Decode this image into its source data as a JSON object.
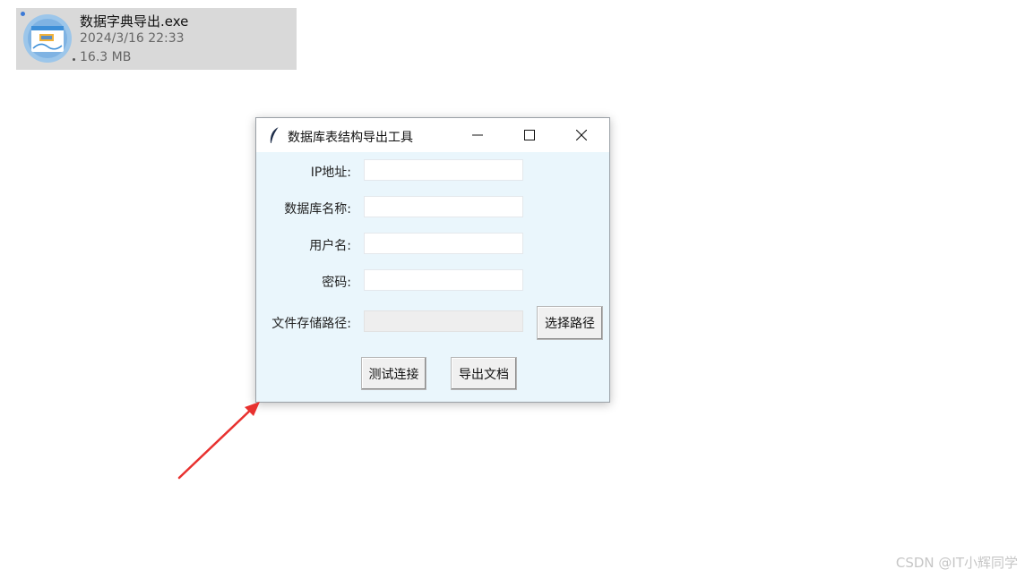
{
  "file": {
    "name": "数据字典导出.exe",
    "date": "2024/3/16 22:33",
    "size": "16.3 MB"
  },
  "window": {
    "title": "数据库表结构导出工具",
    "fields": [
      {
        "label": "IP地址:",
        "value": ""
      },
      {
        "label": "数据库名称:",
        "value": ""
      },
      {
        "label": "用户名:",
        "value": ""
      },
      {
        "label": "密码:",
        "value": ""
      },
      {
        "label": "文件存储路径:",
        "value": ""
      }
    ],
    "select_path_button": "选择路径",
    "test_connection_button": "测试连接",
    "export_doc_button": "导出文档"
  },
  "watermark": "CSDN @IT小辉同学",
  "colors": {
    "annotation_arrow": "#e8312f",
    "window_bg": "#eaf6fc",
    "file_tile_bg": "#d9d9d9"
  }
}
